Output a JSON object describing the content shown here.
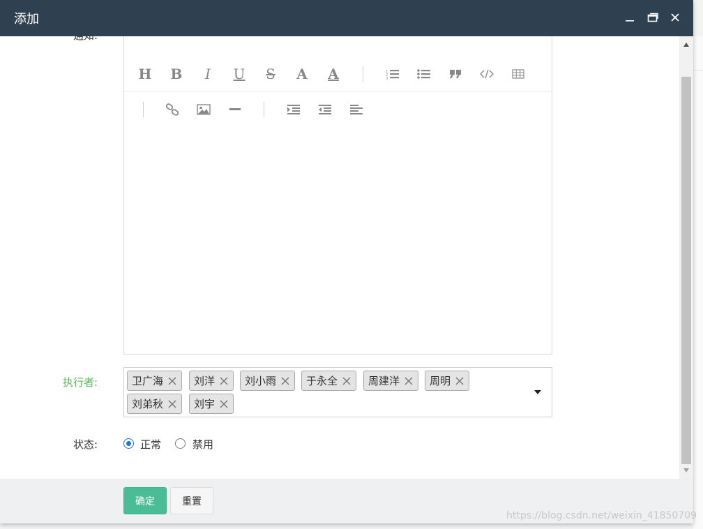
{
  "dialog": {
    "title": "添加",
    "controls": [
      "minimize-icon",
      "maximize-icon",
      "close-icon"
    ]
  },
  "form": {
    "notice_label": "通知:",
    "editor": {
      "toolbar_row1": [
        "H",
        "B",
        "I",
        "U",
        "S",
        "A",
        "A",
        "ordered-list-icon",
        "unordered-list-icon",
        "quote-icon",
        "code-icon",
        "table-icon"
      ],
      "toolbar_row2": [
        "link-icon",
        "image-icon",
        "horizontal-rule-icon",
        "indent-icon",
        "outdent-icon",
        "align-left-icon"
      ],
      "content": ""
    },
    "executor_label": "执行者:",
    "executors": [
      {
        "name": "卫广海"
      },
      {
        "name": "刘洋"
      },
      {
        "name": "刘小雨"
      },
      {
        "name": "于永全"
      },
      {
        "name": "周建洋"
      },
      {
        "name": "周明"
      },
      {
        "name": "刘弟秋"
      },
      {
        "name": "刘宇"
      }
    ],
    "status_label": "状态:",
    "status_options": [
      {
        "label": "正常",
        "checked": true
      },
      {
        "label": "禁用",
        "checked": false
      }
    ]
  },
  "footer": {
    "confirm_label": "确定",
    "reset_label": "重置"
  },
  "watermark": "https://blog.csdn.net/weixin_41850709",
  "colors": {
    "titlebar": "#2f4050",
    "primary_button": "#4bbd96",
    "label_highlight": "#5cb85c",
    "radio_accent": "#1a73e8"
  }
}
